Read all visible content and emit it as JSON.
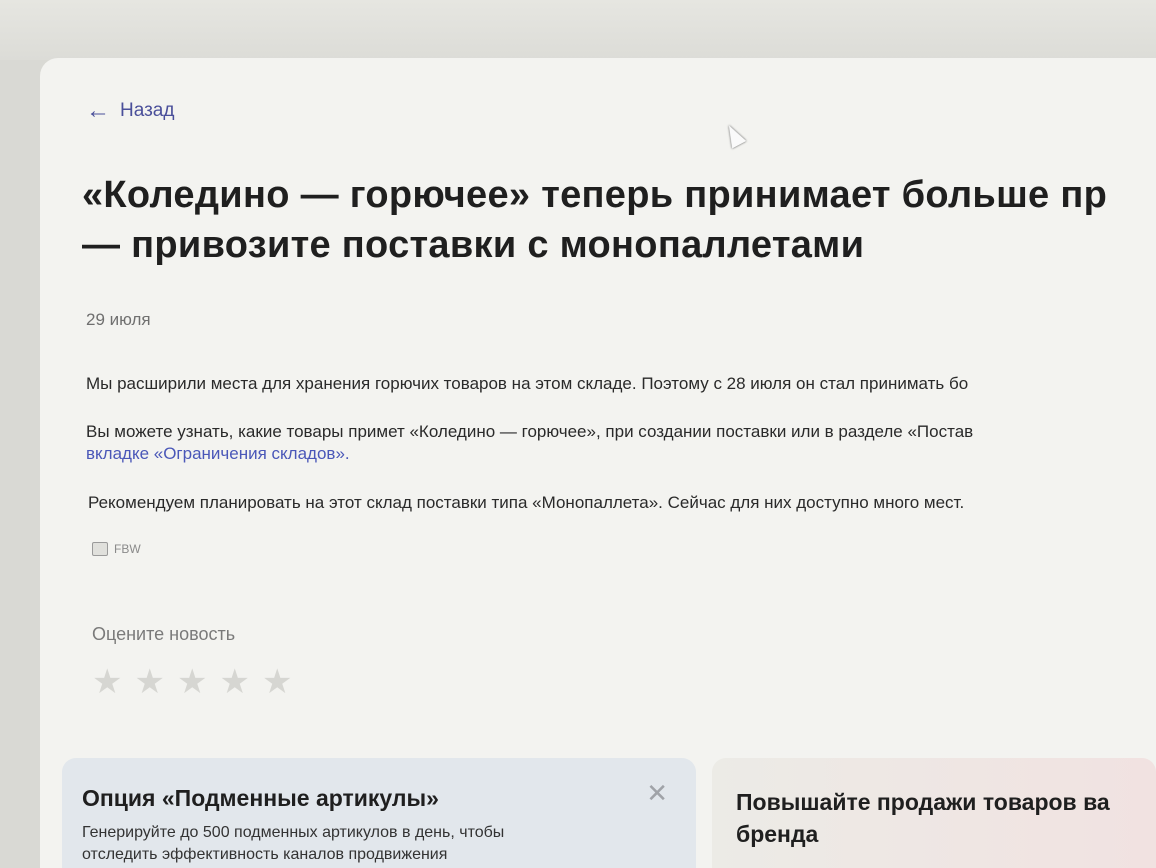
{
  "nav": {
    "back_label": "Назад"
  },
  "article": {
    "title_line1": "«Коледино — горючее» теперь принимает больше пр",
    "title_line2": "— привозите поставки с монопаллетами",
    "date": "29 июля",
    "paragraph1": "Мы расширили места для хранения горючих товаров на этом складе. Поэтому с 28 июля он стал принимать бо",
    "paragraph2": "Вы можете узнать, какие товары примет «Коледино — горючее», при создании поставки или в разделе «Постав",
    "paragraph2_link": "вкладке «Ограничения складов».",
    "paragraph3": "Рекомендуем планировать на этот склад поставки типа «Монопаллета». Сейчас для них доступно много мест.",
    "tag": "FBW"
  },
  "rating": {
    "label": "Оцените новость",
    "stars": 5,
    "value": 0
  },
  "cards": {
    "left": {
      "title": "Опция «Подменные артикулы»",
      "text1": "Генерируйте до 500 подменных артикулов в день, чтобы",
      "text2": "отследить эффективность каналов продвижения"
    },
    "right": {
      "title_line1": "Повышайте продажи товаров ва",
      "title_line2": "бренда"
    }
  },
  "colors": {
    "accent": "#4a57b8",
    "title": "#1f1f1f",
    "background": "#f3f3f0"
  },
  "icons": {
    "back": "arrow-left-icon",
    "tag": "tag-icon",
    "close": "close-icon",
    "star": "star-icon"
  }
}
